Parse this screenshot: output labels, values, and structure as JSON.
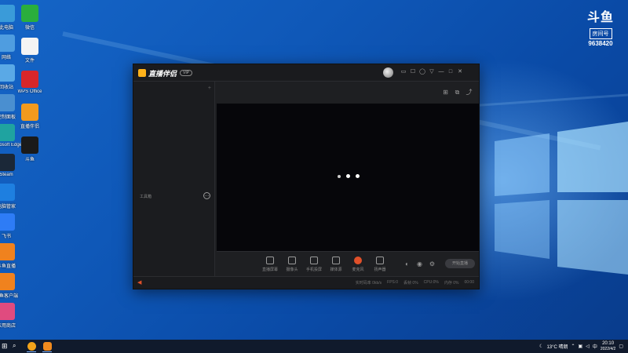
{
  "desktop": {
    "icons_left": [
      {
        "label": "此电脑",
        "color": "#3a9bd9"
      },
      {
        "label": "网络",
        "color": "#4f9de0"
      },
      {
        "label": "回收站",
        "color": "#5aa9e6"
      },
      {
        "label": "控制面板",
        "color": "#4a8fd0"
      },
      {
        "label": "Microsoft Edge",
        "color": "#1fa3a0"
      },
      {
        "label": "Steam",
        "color": "#1b2838"
      },
      {
        "label": "电脑管家",
        "color": "#1e7fe0"
      },
      {
        "label": "飞书",
        "color": "#2e7cf6"
      },
      {
        "label": "斗鱼直播",
        "color": "#f0821e"
      },
      {
        "label": "斗鱼客户端",
        "color": "#f0821e"
      },
      {
        "label": "应用商店",
        "color": "#e04b7f"
      }
    ],
    "icons_col2": [
      {
        "label": "微信",
        "color": "#2aae3c"
      },
      {
        "label": "文件",
        "color": "#f4f4f4"
      },
      {
        "label": "WPS Office",
        "color": "#d8262a"
      },
      {
        "label": "直播伴侣",
        "color": "#f29a1e"
      },
      {
        "label": "斗鱼",
        "color": "#1a1a1a"
      }
    ]
  },
  "watermark": {
    "logo": "斗鱼",
    "room_label": "房间号",
    "room_number": "9638420"
  },
  "app": {
    "name": "直播伴侣",
    "vip_badge": "VIP",
    "window_controls": [
      "▭",
      "☐",
      "◯",
      "▽",
      "—",
      "□",
      "✕"
    ],
    "left_panel": {
      "add_symbol": "+",
      "scene_label": "工具箱",
      "scene_action_symbol": "…"
    },
    "right_head_icons": [
      "⊞",
      "⧉",
      "⤴"
    ],
    "toolbar": {
      "tools": [
        {
          "label": "直播屏幕",
          "name": "screen"
        },
        {
          "label": "摄像头",
          "name": "camera"
        },
        {
          "label": "手机投屏",
          "name": "phone"
        },
        {
          "label": "媒体源",
          "name": "media"
        },
        {
          "label": "麦克风",
          "name": "mic"
        },
        {
          "label": "扬声器",
          "name": "speaker"
        }
      ],
      "start_button": "开始直播"
    },
    "status": {
      "stats": [
        "实时码率 0kb/s",
        "FPS:0",
        "丢帧 0%",
        "CPU:0%",
        "内存 0%",
        "00:00"
      ]
    }
  },
  "taskbar": {
    "weather": "13°C 晴朗",
    "ime": "中",
    "time": "20:10",
    "date": "2022/4/2"
  }
}
